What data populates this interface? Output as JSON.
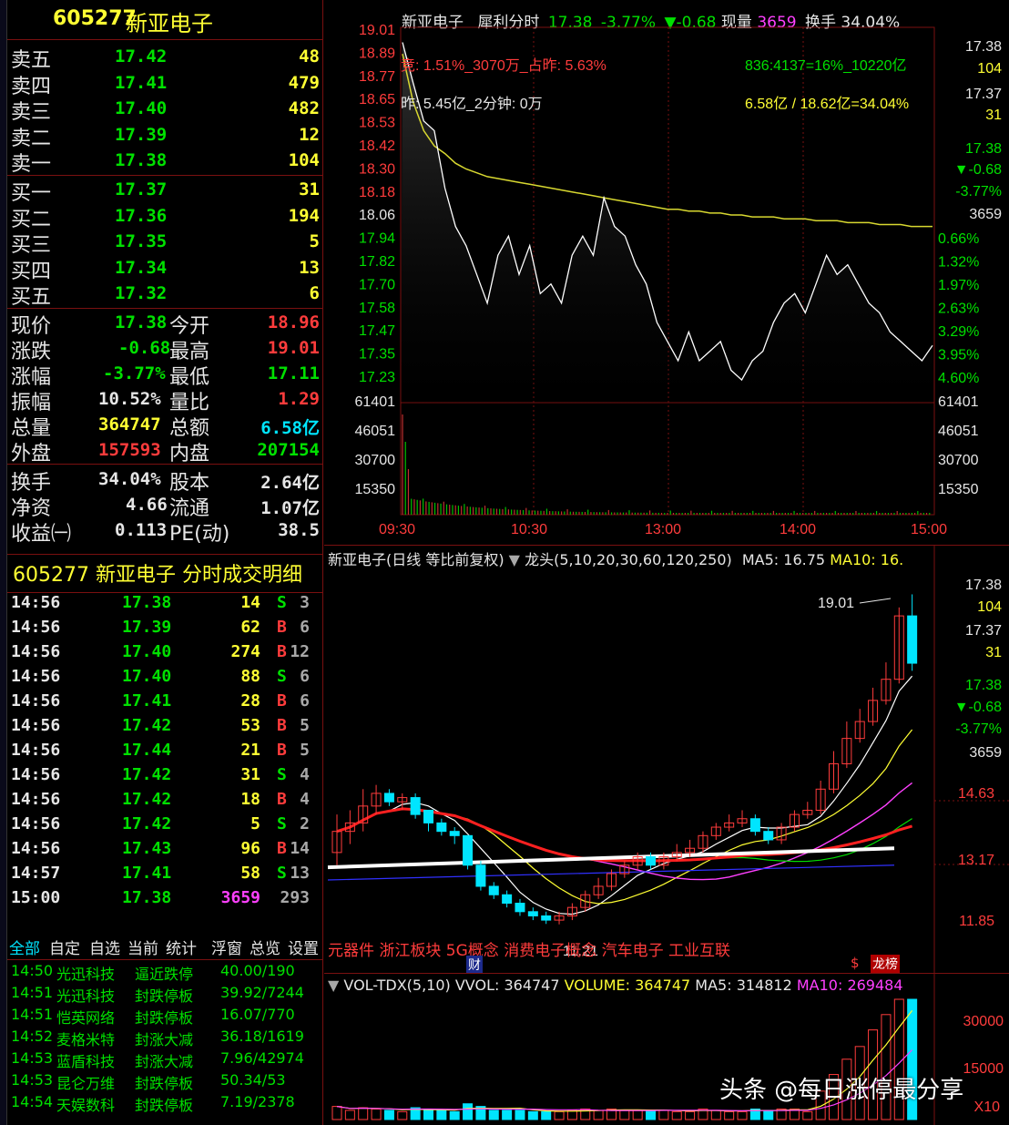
{
  "quote": {
    "code": "605277",
    "name": "新亚电子",
    "asks": [
      {
        "label": "卖五",
        "price": "17.42",
        "vol": "48"
      },
      {
        "label": "卖四",
        "price": "17.41",
        "vol": "479"
      },
      {
        "label": "卖三",
        "price": "17.40",
        "vol": "482"
      },
      {
        "label": "卖二",
        "price": "17.39",
        "vol": "12"
      },
      {
        "label": "卖一",
        "price": "17.38",
        "vol": "104"
      }
    ],
    "bids": [
      {
        "label": "买一",
        "price": "17.37",
        "vol": "31"
      },
      {
        "label": "买二",
        "price": "17.36",
        "vol": "194"
      },
      {
        "label": "买三",
        "price": "17.35",
        "vol": "5"
      },
      {
        "label": "买四",
        "price": "17.34",
        "vol": "13"
      },
      {
        "label": "买五",
        "price": "17.32",
        "vol": "6"
      }
    ],
    "stats": {
      "now_l": "现价",
      "now_v": "17.38",
      "open_l": "今开",
      "open_v": "18.96",
      "chg_l": "涨跌",
      "chg_v": "-0.68",
      "high_l": "最高",
      "high_v": "19.01",
      "pct_l": "涨幅",
      "pct_v": "-3.77%",
      "low_l": "最低",
      "low_v": "17.11",
      "amp_l": "振幅",
      "amp_v": "10.52%",
      "vr_l": "量比",
      "vr_v": "1.29",
      "vol_l": "总量",
      "vol_v": "364747",
      "amt_l": "总额",
      "amt_v": "6.58亿",
      "out_l": "外盘",
      "out_v": "157593",
      "in_l": "内盘",
      "in_v": "207154",
      "turn_l": "换手",
      "turn_v": "34.04%",
      "cap_l": "股本",
      "cap_v": "2.64亿",
      "nav_l": "净资",
      "nav_v": "4.66",
      "float_l": "流通",
      "float_v": "1.07亿",
      "eps_l": "收益㈠",
      "eps_v": "0.113",
      "pe_l": "PE(动)",
      "pe_v": "38.5"
    }
  },
  "ticks": {
    "header": "605277 新亚电子  分时成交明细",
    "rows": [
      {
        "t": "14:56",
        "p": "17.38",
        "v": "14",
        "s": "S",
        "n": "3"
      },
      {
        "t": "14:56",
        "p": "17.39",
        "v": "62",
        "s": "B",
        "n": "6"
      },
      {
        "t": "14:56",
        "p": "17.40",
        "v": "274",
        "s": "B",
        "n": "12"
      },
      {
        "t": "14:56",
        "p": "17.40",
        "v": "88",
        "s": "S",
        "n": "6"
      },
      {
        "t": "14:56",
        "p": "17.41",
        "v": "28",
        "s": "B",
        "n": "6"
      },
      {
        "t": "14:56",
        "p": "17.42",
        "v": "53",
        "s": "B",
        "n": "5"
      },
      {
        "t": "14:56",
        "p": "17.44",
        "v": "21",
        "s": "B",
        "n": "5"
      },
      {
        "t": "14:56",
        "p": "17.42",
        "v": "31",
        "s": "S",
        "n": "4"
      },
      {
        "t": "14:56",
        "p": "17.42",
        "v": "18",
        "s": "B",
        "n": "4"
      },
      {
        "t": "14:56",
        "p": "17.42",
        "v": "5",
        "s": "S",
        "n": "2"
      },
      {
        "t": "14:56",
        "p": "17.43",
        "v": "96",
        "s": "B",
        "n": "14"
      },
      {
        "t": "14:57",
        "p": "17.41",
        "v": "58",
        "s": "S",
        "n": "13"
      },
      {
        "t": "15:00",
        "p": "17.38",
        "v": "3659",
        "s": "",
        "n": "293"
      }
    ]
  },
  "tabs": [
    "全部",
    "自定",
    "自选",
    "当前",
    "统计",
    "浮窗",
    "总览",
    "设置"
  ],
  "news": [
    {
      "t": "14:50",
      "name": "光迅科技",
      "act": "逼近跌停",
      "val": "40.00/190"
    },
    {
      "t": "14:51",
      "name": "光迅科技",
      "act": "封跌停板",
      "val": "39.92/7244"
    },
    {
      "t": "14:51",
      "name": "恺英网络",
      "act": "封跌停板",
      "val": "16.07/770"
    },
    {
      "t": "14:52",
      "name": "麦格米特",
      "act": "封涨大减",
      "val": "36.18/1619"
    },
    {
      "t": "14:53",
      "name": "蓝盾科技",
      "act": "封涨大减",
      "val": "7.96/42974"
    },
    {
      "t": "14:53",
      "name": "昆仑万维",
      "act": "封跌停板",
      "val": "50.34/53"
    },
    {
      "t": "14:54",
      "name": "天娱数科",
      "act": "封跌停板",
      "val": "7.19/2378"
    }
  ],
  "intraday": {
    "title_name": "新亚电子",
    "title_mode": "犀利分时",
    "title_price": "17.38",
    "title_pct": "-3.77%",
    "title_chg": "▼-0.68",
    "title_vol_l": "现量",
    "title_vol_v": "3659",
    "title_turn": "换手 34.04%",
    "ann1": "竞: 1.51%_3070万_占昨: 5.63%",
    "ann2": "昨: 5.45亿_2分钟: 0万",
    "ann3": "836:4137=16%_10220亿",
    "ann4": "6.58亿 / 18.62亿=34.04%",
    "price_ticks": [
      "19.01",
      "18.89",
      "18.77",
      "18.65",
      "18.53",
      "18.42",
      "18.30",
      "18.18",
      "18.06",
      "17.94",
      "17.82",
      "17.70",
      "17.58",
      "17.47",
      "17.35",
      "17.23"
    ],
    "pct_ticks": [
      "0.66%",
      "1.32%",
      "1.97%",
      "2.63%",
      "3.29%",
      "3.95%",
      "4.60%"
    ],
    "vol_ticks": [
      "61401",
      "46051",
      "30700",
      "15350"
    ],
    "times": [
      "09:30",
      "10:30",
      "13:00",
      "14:00",
      "15:00"
    ],
    "right_box": [
      "17.38",
      "104",
      "17.37",
      "31",
      "17.38",
      "▼-0.68",
      "-3.77%",
      "3659"
    ]
  },
  "chart_data": {
    "type": "line",
    "title": "新亚电子 犀利分时",
    "y_range": [
      17.11,
      19.01
    ],
    "price": [
      18.96,
      18.75,
      18.55,
      18.5,
      18.2,
      18.0,
      17.9,
      17.75,
      17.6,
      17.85,
      17.95,
      17.75,
      17.9,
      17.65,
      17.7,
      17.6,
      17.85,
      17.95,
      17.85,
      18.15,
      18.0,
      17.95,
      17.8,
      17.7,
      17.5,
      17.4,
      17.3,
      17.45,
      17.3,
      17.35,
      17.4,
      17.25,
      17.2,
      17.3,
      17.35,
      17.5,
      17.6,
      17.65,
      17.55,
      17.7,
      17.85,
      17.75,
      17.8,
      17.7,
      17.6,
      17.55,
      17.45,
      17.4,
      17.35,
      17.3,
      17.38
    ],
    "avg": [
      18.9,
      18.65,
      18.5,
      18.42,
      18.38,
      18.33,
      18.3,
      18.28,
      18.26,
      18.25,
      18.24,
      18.23,
      18.22,
      18.21,
      18.2,
      18.19,
      18.18,
      18.17,
      18.16,
      18.15,
      18.14,
      18.13,
      18.12,
      18.11,
      18.1,
      18.09,
      18.09,
      18.08,
      18.08,
      18.07,
      18.07,
      18.06,
      18.06,
      18.05,
      18.05,
      18.05,
      18.04,
      18.04,
      18.04,
      18.03,
      18.03,
      18.03,
      18.02,
      18.02,
      18.02,
      18.01,
      18.01,
      18.01,
      18.0,
      18.0,
      18.0
    ]
  },
  "kline": {
    "title": "新亚电子(日线 等比前复权)",
    "ind": "龙头(5,10,20,30,60,120,250)",
    "ma5": "MA5: 16.75",
    "ma10": "MA10: 16.",
    "high_label": "19.01",
    "low_label": "11.21",
    "y_ticks": [
      "14.63",
      "13.17",
      "11.85"
    ],
    "right_box": [
      "17.38",
      "104",
      "17.37",
      "31",
      "17.38",
      "▼-0.68",
      "-3.77%",
      "3659"
    ],
    "concepts": "元器件 浙江板块 5G概念 消费电子概念 汽车电子 工业互联",
    "fin_badge": "财",
    "dollar": "$",
    "rank": "龙榜"
  },
  "kline_candles": {
    "o": [
      12.9,
      13.4,
      13.6,
      14.0,
      14.3,
      14.1,
      14.2,
      13.9,
      13.6,
      13.4,
      13.3,
      12.6,
      12.1,
      11.9,
      11.7,
      11.5,
      11.4,
      11.3,
      11.4,
      11.6,
      11.9,
      12.1,
      12.4,
      12.6,
      12.8,
      12.6,
      12.8,
      12.9,
      13.0,
      13.3,
      13.5,
      13.6,
      13.7,
      13.4,
      13.2,
      13.5,
      13.8,
      13.9,
      14.4,
      15.0,
      15.6,
      16.0,
      16.5,
      17.0,
      18.5
    ],
    "c": [
      13.4,
      13.6,
      14.0,
      14.3,
      14.1,
      14.2,
      13.8,
      13.6,
      13.4,
      13.3,
      12.6,
      12.1,
      11.9,
      11.7,
      11.5,
      11.4,
      11.3,
      11.4,
      11.6,
      11.9,
      12.1,
      12.4,
      12.6,
      12.8,
      12.6,
      12.8,
      12.9,
      13.0,
      13.3,
      13.5,
      13.6,
      13.7,
      13.4,
      13.2,
      13.5,
      13.8,
      13.9,
      14.4,
      15.0,
      15.6,
      16.0,
      16.5,
      17.0,
      18.5,
      17.38
    ],
    "h": [
      13.8,
      13.9,
      14.4,
      14.5,
      14.4,
      14.3,
      14.3,
      13.9,
      13.7,
      13.5,
      13.3,
      12.7,
      12.2,
      12.0,
      11.8,
      11.6,
      11.5,
      11.5,
      11.7,
      12.0,
      12.3,
      12.5,
      12.7,
      12.9,
      12.9,
      12.9,
      13.1,
      13.2,
      13.4,
      13.6,
      13.8,
      13.9,
      13.8,
      13.5,
      13.6,
      13.9,
      14.1,
      14.6,
      15.3,
      16.0,
      16.3,
      16.8,
      17.4,
      18.7,
      19.01
    ],
    "l": [
      12.6,
      13.1,
      13.4,
      13.8,
      14.0,
      13.9,
      13.7,
      13.4,
      13.3,
      13.1,
      12.5,
      12.0,
      11.8,
      11.6,
      11.4,
      11.3,
      11.21,
      11.2,
      11.3,
      11.5,
      11.8,
      12.0,
      12.3,
      12.5,
      12.5,
      12.5,
      12.7,
      12.8,
      12.9,
      13.2,
      13.4,
      13.5,
      13.3,
      13.1,
      13.1,
      13.4,
      13.7,
      13.8,
      14.3,
      14.9,
      15.5,
      15.9,
      16.4,
      16.9,
      17.2
    ]
  },
  "volpanel": {
    "ind": "VOL-TDX(5,10)",
    "vvol": "VVOL: 364747",
    "volume": "VOLUME: 364747",
    "ma5": "MA5: 314812",
    "ma10": "MA10: 269484",
    "ticks": [
      "30000",
      "15000"
    ],
    "x10": "X10"
  },
  "watermark": "头条 @每日涨停最分享",
  "colors": {
    "up": "#ff3c3c",
    "down": "#00e5ff",
    "grid": "#7a1010",
    "avg": "#d8d830"
  }
}
